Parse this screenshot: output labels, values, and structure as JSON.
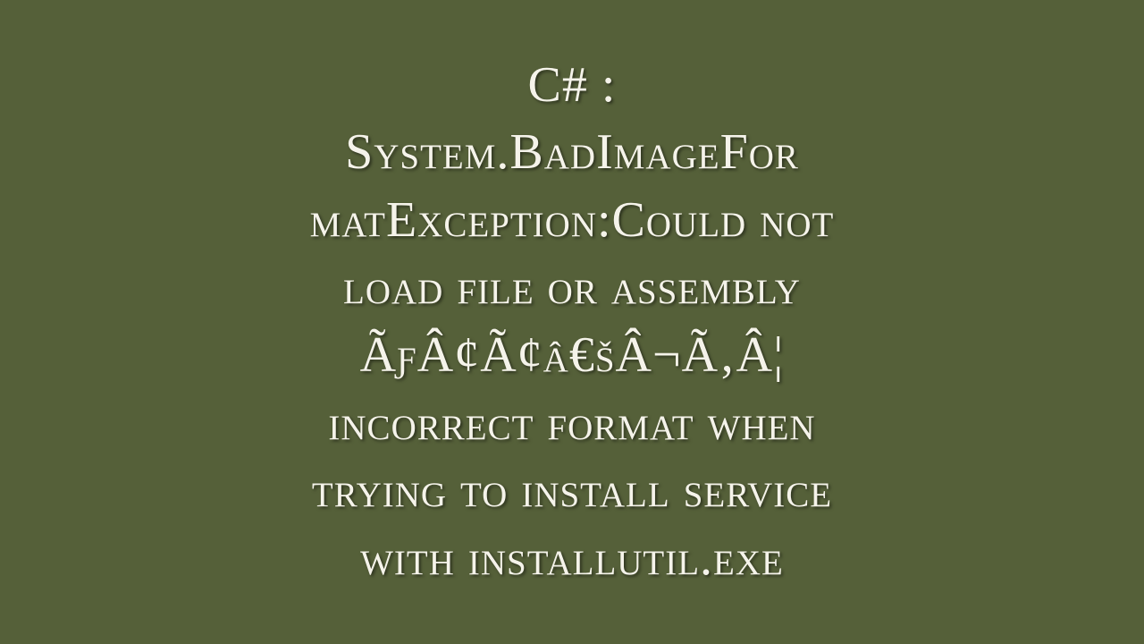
{
  "title": {
    "lines": [
      "C# :",
      "System.BadImageFor",
      "matException:Could not",
      "load file or assembly",
      "ÃƒÂ¢Ã¢â€šÂ¬Ã‚Â¦",
      "incorrect format when",
      "trying to install service",
      "with installutil.exe"
    ]
  }
}
